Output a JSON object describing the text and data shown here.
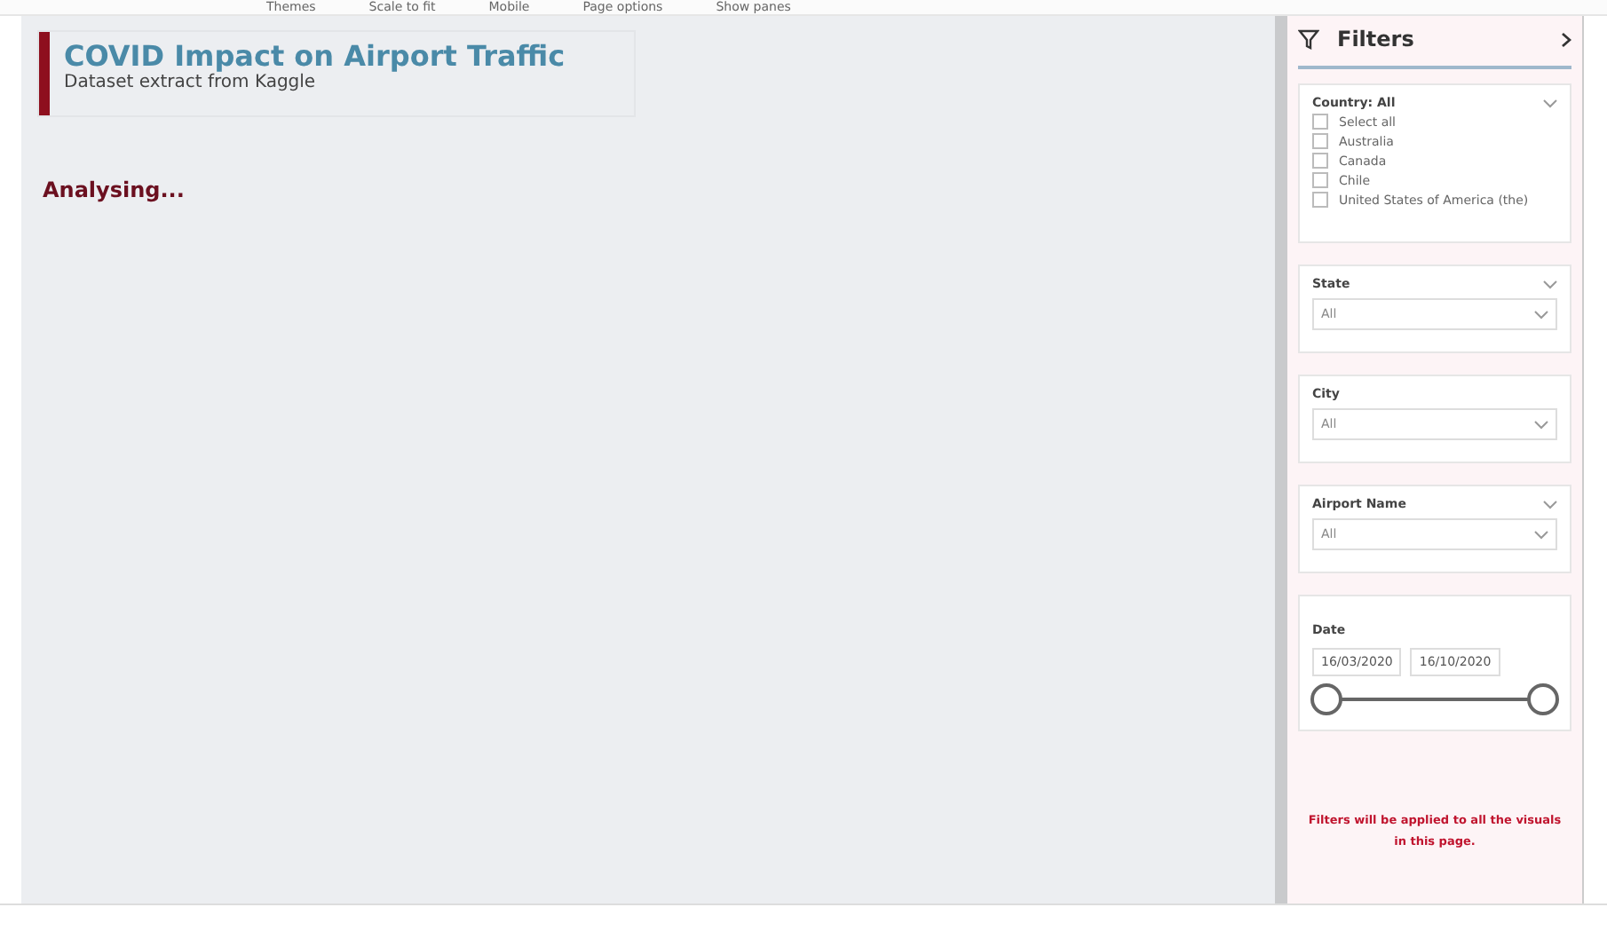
{
  "toolbar": {
    "items": [
      "Themes",
      "Scale to fit",
      "Mobile",
      "Page options",
      "Show panes"
    ]
  },
  "report": {
    "title": "COVID Impact on Airport Traffic",
    "subtitle": "Dataset extract from Kaggle",
    "status": "Analysing..."
  },
  "filters": {
    "title": "Filters",
    "cards": [
      {
        "kind": "list",
        "label": "Country: All",
        "options": [
          {
            "label": "Select all",
            "checked": false
          },
          {
            "label": "Australia",
            "checked": false
          },
          {
            "label": "Canada",
            "checked": false
          },
          {
            "label": "Chile",
            "checked": false
          },
          {
            "label": "United States of America (the)",
            "checked": false
          }
        ]
      },
      {
        "kind": "dropdown",
        "label": "State",
        "value": "All",
        "collapsible": true
      },
      {
        "kind": "dropdown",
        "label": "City",
        "value": "All",
        "collapsible": false
      },
      {
        "kind": "dropdown",
        "label": "Airport Name",
        "value": "All",
        "collapsible": true
      },
      {
        "kind": "date",
        "label": "Date",
        "from": "16/03/2020",
        "to": "16/10/2020",
        "level": 1
      }
    ],
    "note": "Filters will be applied to all the visuals in this page."
  }
}
